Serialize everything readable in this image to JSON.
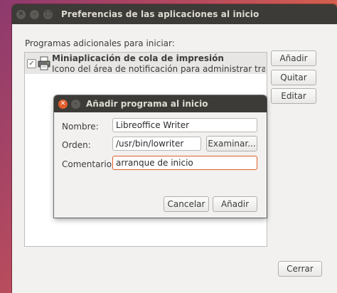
{
  "window": {
    "title": "Preferencias de las aplicaciones al inicio",
    "close_glyph": "✕",
    "min_glyph": "–",
    "max_glyph": "□"
  },
  "main": {
    "section_label": "Programas adicionales para iniciar:",
    "items": [
      {
        "checked": true,
        "check_glyph": "✓",
        "icon": "printer-icon",
        "title": "Miniaplicación de cola de impresión",
        "description": "Icono del área de notificación para administrar trabajos …"
      }
    ],
    "buttons": {
      "add": "Añadir",
      "remove": "Quitar",
      "edit": "Editar",
      "close": "Cerrar"
    }
  },
  "dialog": {
    "title": "Añadir programa al inicio",
    "close_glyph": "✕",
    "min_glyph": "–",
    "name_label": "Nombre:",
    "name_value": "Libreoffice Writer",
    "command_label": "Orden:",
    "command_value": "/usr/bin/lowriter",
    "browse_button": "Examinar...",
    "comment_label": "Comentario:",
    "comment_value": "arranque de inicio",
    "cancel_button": "Cancelar",
    "add_button": "Añadir"
  },
  "colors": {
    "titlebar": "#3c3b37",
    "accent": "#e05e2c",
    "window_bg": "#f2f1f0"
  }
}
